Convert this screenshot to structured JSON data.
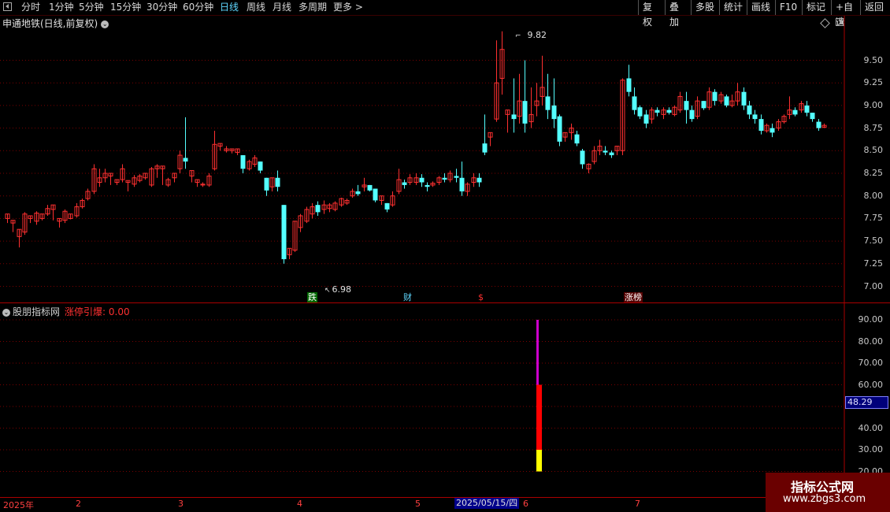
{
  "toolbar": {
    "periods": [
      "分时",
      "1分钟",
      "5分钟",
      "15分钟",
      "30分钟",
      "60分钟",
      "日线",
      "周线",
      "月线",
      "多周期",
      "更多 >"
    ],
    "active_period": "日线",
    "right_buttons": [
      "复权",
      "叠加",
      "多股",
      "统计",
      "画线",
      "F10",
      "标记",
      "+自选",
      "返回"
    ]
  },
  "stock": {
    "title": "申通地铁(日线,前复权)",
    "high_marker": "9.82",
    "low_marker": "6.98",
    "price_axis": [
      "9.50",
      "9.25",
      "9.00",
      "8.75",
      "8.50",
      "8.25",
      "8.00",
      "7.75",
      "7.50",
      "7.25",
      "7.00"
    ]
  },
  "event_tags": [
    {
      "text": "跌",
      "bg": "#006600",
      "fg": "#ffffff"
    },
    {
      "text": "财",
      "bg": "#000000",
      "fg": "#5fd7ff"
    },
    {
      "text": "$",
      "bg": "#000000",
      "fg": "#ff3030"
    },
    {
      "text": "涨榜",
      "bg": "#550000",
      "fg": "#ffffff"
    }
  ],
  "indicator": {
    "name": "股朋指标网",
    "value_label": "涨停引爆: 0.00",
    "axis": [
      "90.00",
      "80.00",
      "70.00",
      "60.00",
      "50.00",
      "40.00",
      "30.00",
      "20.00"
    ],
    "current_value": "48.29",
    "bar_segments": [
      {
        "from": 20,
        "to": 30,
        "color": "#ffff00"
      },
      {
        "from": 30,
        "to": 60,
        "color": "#ff0000"
      },
      {
        "from": 60,
        "to": 90,
        "color": "#cc00cc"
      }
    ]
  },
  "date_axis": {
    "labels": [
      "2025年",
      "2",
      "3",
      "4",
      "5",
      "6",
      "7"
    ],
    "cursor": "2025/05/15/四"
  },
  "watermark": {
    "line1": "指标公式网",
    "line2": "www.zbgs3.com"
  },
  "colors": {
    "up": "#ff3030",
    "down": "#54ffff",
    "grid": "#7a0000",
    "background": "#000000"
  },
  "chart_data": {
    "type": "candlestick",
    "title": "申通地铁(日线,前复权)",
    "ylim": [
      6.9,
      9.95
    ],
    "candles": [
      [
        7.75,
        7.8,
        7.7,
        7.65
      ],
      [
        7.7,
        7.73,
        7.6,
        7.55
      ],
      [
        7.55,
        7.63,
        7.43,
        7.45
      ],
      [
        7.6,
        7.8,
        7.57,
        7.82
      ],
      [
        7.75,
        7.78,
        7.7,
        7.68
      ],
      [
        7.72,
        7.81,
        7.68,
        7.83
      ],
      [
        7.75,
        7.8,
        7.73,
        7.72
      ],
      [
        7.8,
        7.86,
        7.78,
        7.9
      ],
      [
        7.85,
        7.9,
        7.73,
        7.74
      ],
      [
        7.72,
        7.75,
        7.65,
        7.63
      ],
      [
        7.73,
        7.83,
        7.7,
        7.85
      ],
      [
        7.75,
        7.8,
        7.74,
        7.72
      ],
      [
        7.78,
        7.88,
        7.76,
        7.92
      ],
      [
        7.88,
        7.95,
        7.86,
        7.97
      ],
      [
        7.97,
        8.05,
        7.95,
        8.08
      ],
      [
        8.05,
        8.3,
        8.02,
        8.35
      ],
      [
        8.15,
        8.2,
        8.1,
        8.3
      ],
      [
        8.2,
        8.25,
        8.15,
        8.3
      ],
      [
        8.22,
        8.25,
        8.12,
        8.18
      ],
      [
        8.15,
        8.18,
        8.12,
        8.1
      ],
      [
        8.18,
        8.3,
        8.15,
        8.35
      ],
      [
        8.15,
        8.17,
        8.05,
        8.03
      ],
      [
        8.13,
        8.2,
        8.1,
        8.23
      ],
      [
        8.17,
        8.22,
        8.15,
        8.24
      ],
      [
        8.2,
        8.25,
        8.18,
        8.15
      ],
      [
        8.12,
        8.3,
        8.1,
        8.32
      ],
      [
        8.3,
        8.33,
        8.2,
        8.35
      ],
      [
        8.3,
        8.33,
        8.12,
        8.07
      ],
      [
        8.12,
        8.18,
        8.1,
        8.2
      ],
      [
        8.2,
        8.25,
        8.15,
        8.23
      ],
      [
        8.3,
        8.45,
        8.25,
        8.5
      ],
      [
        8.42,
        8.38,
        8.3,
        8.87
      ],
      [
        8.22,
        8.28,
        8.15,
        8.12
      ],
      [
        8.15,
        8.18,
        8.1,
        8.08
      ],
      [
        8.12,
        8.13,
        8.1,
        8.15
      ],
      [
        8.12,
        8.22,
        8.1,
        8.25
      ],
      [
        8.3,
        8.57,
        8.28,
        8.72
      ],
      [
        8.55,
        8.58,
        8.5,
        8.5
      ],
      [
        8.5,
        8.52,
        8.48,
        8.55
      ],
      [
        8.5,
        8.52,
        8.47,
        8.45
      ],
      [
        8.48,
        8.52,
        8.45,
        8.5
      ],
      [
        8.45,
        8.3,
        8.25,
        8.23
      ],
      [
        8.3,
        8.38,
        8.28,
        8.4
      ],
      [
        8.35,
        8.42,
        8.32,
        8.45
      ],
      [
        8.38,
        8.28,
        8.25,
        8.22
      ],
      [
        8.2,
        8.06,
        8.0,
        7.92
      ],
      [
        8.1,
        8.2,
        8.05,
        8.2
      ],
      [
        8.2,
        8.1,
        8.05,
        8.28
      ],
      [
        7.9,
        7.3,
        7.25,
        7.26
      ],
      [
        7.35,
        7.42,
        7.3,
        7.28
      ],
      [
        7.4,
        7.72,
        7.38,
        6.98
      ],
      [
        7.65,
        7.78,
        7.6,
        7.8
      ],
      [
        7.72,
        7.85,
        7.7,
        7.88
      ],
      [
        7.8,
        7.88,
        7.75,
        7.92
      ],
      [
        7.9,
        7.82,
        7.78,
        7.94
      ],
      [
        7.85,
        7.9,
        7.8,
        7.95
      ],
      [
        7.86,
        7.9,
        7.82,
        7.92
      ],
      [
        7.85,
        7.92,
        7.83,
        7.94
      ],
      [
        7.9,
        7.97,
        7.88,
        7.98
      ],
      [
        7.92,
        7.95,
        7.9,
        7.97
      ],
      [
        8.0,
        8.05,
        7.98,
        8.08
      ],
      [
        8.05,
        8.02,
        8.0,
        8.12
      ],
      [
        8.1,
        8.12,
        8.05,
        8.2
      ],
      [
        8.12,
        8.06,
        8.05,
        8.1
      ],
      [
        8.08,
        7.95,
        7.93,
        7.92
      ],
      [
        7.95,
        8.0,
        7.9,
        7.88
      ],
      [
        7.92,
        7.85,
        7.82,
        7.8
      ],
      [
        7.9,
        8.0,
        7.88,
        8.05
      ],
      [
        8.05,
        8.18,
        8.02,
        8.3
      ],
      [
        8.15,
        8.12,
        8.08,
        8.18
      ],
      [
        8.15,
        8.2,
        8.12,
        8.24
      ],
      [
        8.15,
        8.2,
        8.12,
        8.25
      ],
      [
        8.2,
        8.15,
        8.1,
        8.24
      ],
      [
        8.12,
        8.1,
        8.05,
        8.15
      ],
      [
        8.12,
        8.14,
        8.1,
        8.16
      ],
      [
        8.15,
        8.2,
        8.12,
        8.22
      ],
      [
        8.2,
        8.18,
        8.15,
        8.25
      ],
      [
        8.18,
        8.25,
        8.15,
        8.28
      ],
      [
        8.22,
        8.2,
        8.15,
        8.3
      ],
      [
        8.2,
        8.05,
        8.0,
        8.38
      ],
      [
        8.05,
        8.13,
        8.0,
        8.15
      ],
      [
        8.15,
        8.2,
        8.1,
        8.25
      ],
      [
        8.2,
        8.15,
        8.1,
        8.25
      ],
      [
        8.58,
        8.48,
        8.45,
        8.9
      ],
      [
        8.65,
        8.7,
        8.55,
        8.6
      ],
      [
        8.85,
        9.25,
        8.82,
        9.72
      ],
      [
        9.3,
        9.62,
        9.12,
        9.82
      ],
      [
        8.9,
        8.95,
        8.7,
        8.65
      ],
      [
        8.9,
        8.85,
        8.7,
        9.3
      ],
      [
        8.88,
        9.05,
        8.8,
        9.35
      ],
      [
        9.05,
        8.8,
        8.7,
        9.5
      ],
      [
        8.82,
        8.9,
        8.75,
        9.2
      ],
      [
        9.0,
        9.05,
        8.88,
        9.25
      ],
      [
        9.1,
        9.2,
        9.0,
        9.55
      ],
      [
        9.1,
        8.95,
        8.85,
        9.35
      ],
      [
        9.0,
        8.85,
        8.75,
        9.3
      ],
      [
        8.88,
        8.6,
        8.55,
        8.9
      ],
      [
        8.65,
        8.7,
        8.6,
        8.7
      ],
      [
        8.7,
        8.75,
        8.62,
        8.8
      ],
      [
        8.68,
        8.58,
        8.55,
        8.72
      ],
      [
        8.5,
        8.35,
        8.3,
        8.52
      ],
      [
        8.3,
        8.35,
        8.25,
        8.36
      ],
      [
        8.38,
        8.5,
        8.35,
        8.55
      ],
      [
        8.5,
        8.55,
        8.45,
        8.62
      ],
      [
        8.5,
        8.48,
        8.45,
        8.55
      ],
      [
        8.48,
        8.45,
        8.42,
        8.5
      ],
      [
        8.5,
        8.55,
        8.45,
        8.55
      ],
      [
        8.5,
        9.28,
        8.45,
        9.3
      ],
      [
        9.3,
        9.15,
        9.1,
        9.45
      ],
      [
        9.1,
        8.95,
        8.9,
        9.2
      ],
      [
        8.98,
        8.88,
        8.85,
        9.0
      ],
      [
        8.9,
        8.8,
        8.75,
        8.95
      ],
      [
        8.85,
        8.95,
        8.8,
        8.98
      ],
      [
        8.95,
        8.92,
        8.88,
        8.98
      ],
      [
        8.9,
        8.95,
        8.85,
        8.98
      ],
      [
        8.95,
        8.92,
        8.9,
        8.98
      ],
      [
        8.9,
        8.98,
        8.88,
        9.0
      ],
      [
        8.95,
        9.1,
        8.92,
        9.15
      ],
      [
        9.05,
        8.95,
        8.8,
        9.15
      ],
      [
        8.95,
        8.85,
        8.82,
        9.0
      ],
      [
        8.88,
        9.05,
        8.85,
        9.1
      ],
      [
        9.05,
        8.97,
        8.95,
        9.05
      ],
      [
        8.98,
        9.15,
        8.95,
        9.2
      ],
      [
        9.15,
        9.05,
        9.0,
        9.18
      ],
      [
        9.05,
        9.12,
        9.02,
        9.15
      ],
      [
        9.1,
        9.0,
        8.98,
        9.12
      ],
      [
        9.0,
        9.05,
        8.98,
        9.12
      ],
      [
        9.05,
        9.15,
        9.0,
        9.25
      ],
      [
        9.15,
        9.0,
        8.95,
        9.2
      ],
      [
        9.0,
        8.9,
        8.85,
        9.05
      ],
      [
        8.9,
        8.85,
        8.8,
        8.95
      ],
      [
        8.85,
        8.72,
        8.68,
        8.9
      ],
      [
        8.72,
        8.78,
        8.7,
        8.8
      ],
      [
        8.75,
        8.7,
        8.65,
        8.8
      ],
      [
        8.75,
        8.82,
        8.72,
        8.85
      ],
      [
        8.82,
        8.88,
        8.8,
        8.9
      ],
      [
        8.9,
        8.95,
        8.85,
        9.1
      ],
      [
        8.95,
        8.9,
        8.88,
        8.98
      ],
      [
        8.95,
        9.02,
        8.92,
        9.05
      ],
      [
        9.0,
        8.92,
        8.88,
        9.05
      ],
      [
        8.92,
        8.85,
        8.82,
        8.92
      ],
      [
        8.82,
        8.75,
        8.72,
        8.85
      ],
      [
        8.76,
        8.78,
        8.75,
        8.8
      ]
    ]
  }
}
